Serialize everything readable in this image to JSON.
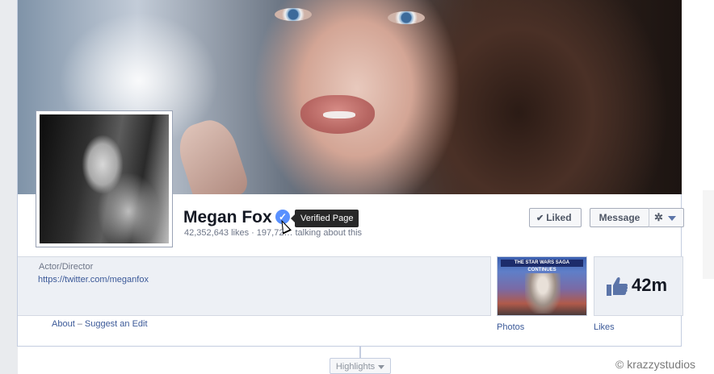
{
  "page": {
    "name": "Megan Fox",
    "verified_tooltip": "Verified Page",
    "likes_text": "42,352,643 likes",
    "talking_text": "197,72… talking about this"
  },
  "actions": {
    "liked_label": "Liked",
    "message_label": "Message"
  },
  "info": {
    "category": "Actor/Director",
    "link": "https://twitter.com/meganfox",
    "about_label": "About",
    "suggest_label": "Suggest an Edit"
  },
  "apps": {
    "photos_label": "Photos",
    "photos_banner": "THE STAR WARS SAGA CONTINUES",
    "likes_label": "Likes",
    "likes_count": "42m"
  },
  "timeline": {
    "highlights_label": "Highlights"
  },
  "watermark": "© krazzystudios",
  "colors": {
    "link": "#3b5998",
    "verified": "#5890ff"
  },
  "icons": [
    "verified-badge-icon",
    "check-icon",
    "gear-icon",
    "chevron-down-icon",
    "thumbs-up-icon",
    "cursor-icon"
  ]
}
